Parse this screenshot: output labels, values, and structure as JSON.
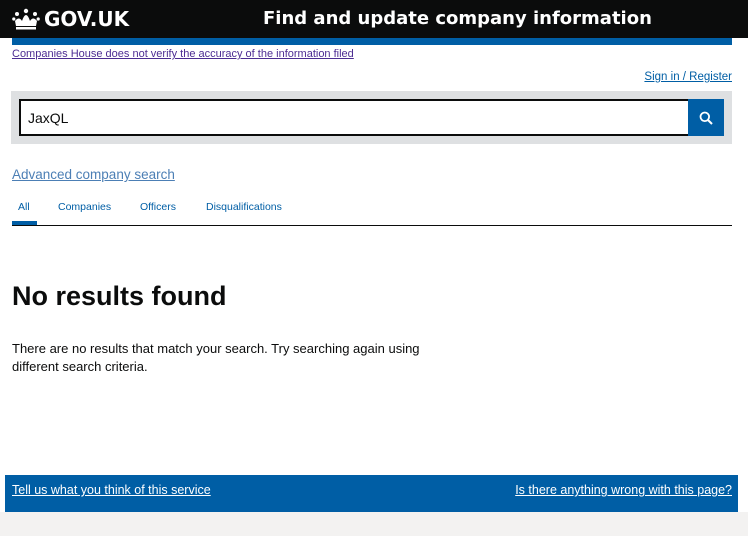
{
  "header": {
    "logo_text": "GOV.UK",
    "service_name": "Find and update company information"
  },
  "disclaimer": "Companies House does not verify the accuracy of the information filed",
  "auth": {
    "signin_label": "Sign in / Register"
  },
  "search": {
    "value": "JaxQL",
    "button_icon": "search-icon"
  },
  "advanced_search_label": "Advanced company search",
  "tabs": [
    {
      "label": "All",
      "selected": true
    },
    {
      "label": "Companies",
      "selected": false
    },
    {
      "label": "Officers",
      "selected": false
    },
    {
      "label": "Disqualifications",
      "selected": false
    }
  ],
  "results": {
    "heading": "No results found",
    "message": "There are no results that match your search. Try searching again using different search criteria."
  },
  "footer": {
    "feedback_link": "Tell us what you think of this service",
    "report_link": "Is there anything wrong with this page?"
  },
  "colors": {
    "header_bg": "#0b0c0c",
    "brand_blue": "#005ea5",
    "search_bg": "#dee0e2"
  }
}
